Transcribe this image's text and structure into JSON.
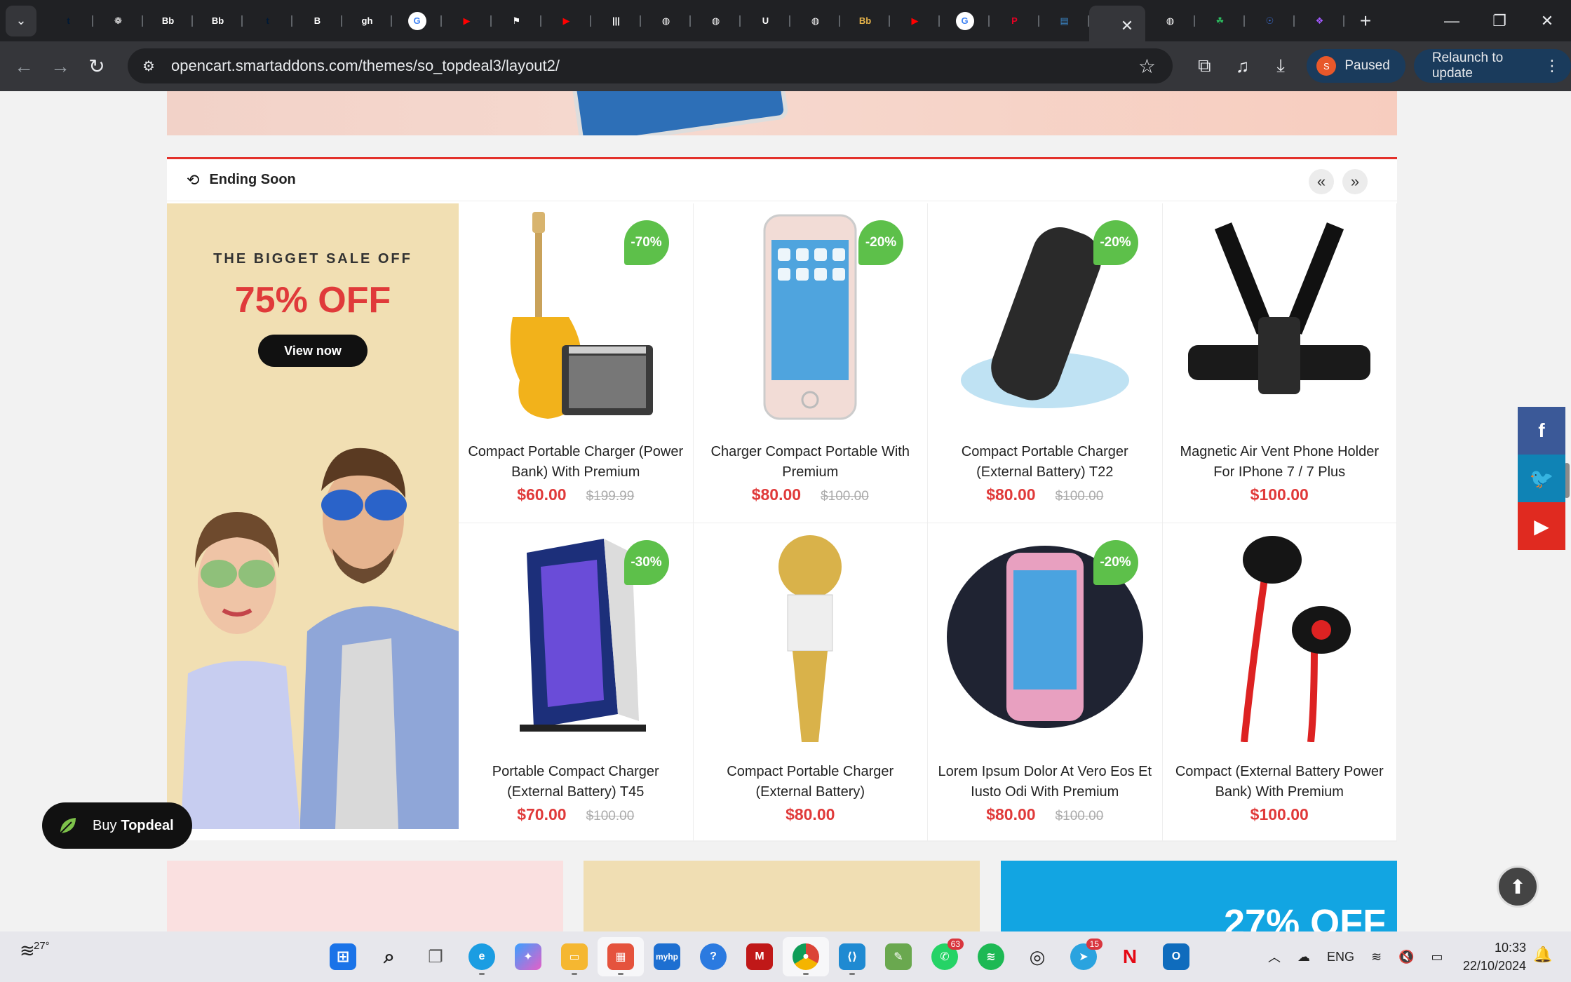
{
  "browser": {
    "tabs": [
      {
        "icon": "tumblr-icon",
        "glyph": "t",
        "color": "#001935"
      },
      {
        "icon": "openai-icon",
        "glyph": "❁",
        "color": "#202124"
      },
      {
        "icon": "behance-icon",
        "glyph": "Bb",
        "color": "#202124"
      },
      {
        "icon": "behance-icon",
        "glyph": "Bb",
        "color": "#202124"
      },
      {
        "icon": "tumblr-icon",
        "glyph": "t",
        "color": "#001935"
      },
      {
        "icon": "bold-logo-icon",
        "glyph": "B",
        "color": "#202124"
      },
      {
        "icon": "gfx-icon",
        "glyph": "gh",
        "color": "#202124"
      },
      {
        "icon": "google-icon",
        "glyph": "G",
        "color": "#ffffff"
      },
      {
        "icon": "youtube-icon",
        "glyph": "▶",
        "color": "#ff0000"
      },
      {
        "icon": "flag-icon",
        "glyph": "⚑",
        "color": "#202124"
      },
      {
        "icon": "youtube-icon",
        "glyph": "▶",
        "color": "#ff0000"
      },
      {
        "icon": "library-icon",
        "glyph": "|||",
        "color": "#202124"
      },
      {
        "icon": "globe-icon",
        "glyph": "◍",
        "color": "#202124"
      },
      {
        "icon": "globe-icon",
        "glyph": "◍",
        "color": "#202124"
      },
      {
        "icon": "u-logo-icon",
        "glyph": "U",
        "color": "#202124"
      },
      {
        "icon": "globe-icon",
        "glyph": "◍",
        "color": "#202124"
      },
      {
        "icon": "behance-icon",
        "glyph": "Bb",
        "color": "#e6b34a"
      },
      {
        "icon": "youtube-icon",
        "glyph": "▶",
        "color": "#ff0000"
      },
      {
        "icon": "google-icon",
        "glyph": "G",
        "color": "#ffffff"
      },
      {
        "icon": "pinterest-icon",
        "glyph": "P",
        "color": "#e60023"
      },
      {
        "icon": "sheet-icon",
        "glyph": "▤",
        "color": "#3a86c8"
      }
    ],
    "tabs_after_active": [
      {
        "icon": "globe-icon",
        "glyph": "◍",
        "color": "#202124"
      },
      {
        "icon": "evernote-icon",
        "glyph": "☘",
        "color": "#2dbe60"
      },
      {
        "icon": "shield-face-icon",
        "glyph": "☉",
        "color": "#3b6fd6"
      },
      {
        "icon": "figma-icon",
        "glyph": "❖",
        "color": "#a259ff"
      }
    ],
    "url": "opencart.smartaddons.com/themes/so_topdeal3/layout2/",
    "profile_initial": "S",
    "paused_label": "Paused",
    "relaunch_label": "Relaunch to update"
  },
  "deal": {
    "title": "Ending Soon",
    "promo": {
      "kicker": "THE BIGGET SALE OFF",
      "headline": "75% OFF",
      "button": "View now"
    },
    "products": [
      {
        "name": "Compact Portable Charger (Power Bank) With Premium",
        "price": "$60.00",
        "old_price": "$199.99",
        "discount": "-70%",
        "image": "guitar"
      },
      {
        "name": "Charger Compact Portable With Premium",
        "price": "$80.00",
        "old_price": "$100.00",
        "discount": "-20%",
        "image": "phone"
      },
      {
        "name": "Compact Portable Charger (External Battery) T22",
        "price": "$80.00",
        "old_price": "$100.00",
        "discount": "-20%",
        "image": "speaker"
      },
      {
        "name": "Magnetic Air Vent Phone Holder For IPhone 7 / 7 Plus",
        "price": "$100.00",
        "old_price": "",
        "discount": "",
        "image": "harness"
      },
      {
        "name": "Portable Compact Charger (External Battery) T45",
        "price": "$70.00",
        "old_price": "$100.00",
        "discount": "-30%",
        "image": "pc"
      },
      {
        "name": "Compact Portable Charger (External Battery)",
        "price": "$80.00",
        "old_price": "",
        "discount": "",
        "image": "mic"
      },
      {
        "name": "Lorem Ipsum Dolor At Vero Eos Et Iusto Odi With Premium",
        "price": "$80.00",
        "old_price": "$100.00",
        "discount": "-20%",
        "image": "armband"
      },
      {
        "name": "Compact (External Battery Power Bank) With Premium",
        "price": "$100.00",
        "old_price": "",
        "discount": "",
        "image": "earphones"
      }
    ]
  },
  "bottom_banner_text": "27% OFF",
  "buy_button": {
    "prefix": "Buy",
    "brand": "Topdeal"
  },
  "taskbar": {
    "temperature": "27°",
    "language": "ENG",
    "time": "10:33",
    "date": "22/10/2024",
    "whatsapp_count": "63",
    "telegram_count": "15"
  },
  "colors": {
    "accent": "#e3312b",
    "badge": "#5dc04a",
    "price": "#e03a3a"
  }
}
